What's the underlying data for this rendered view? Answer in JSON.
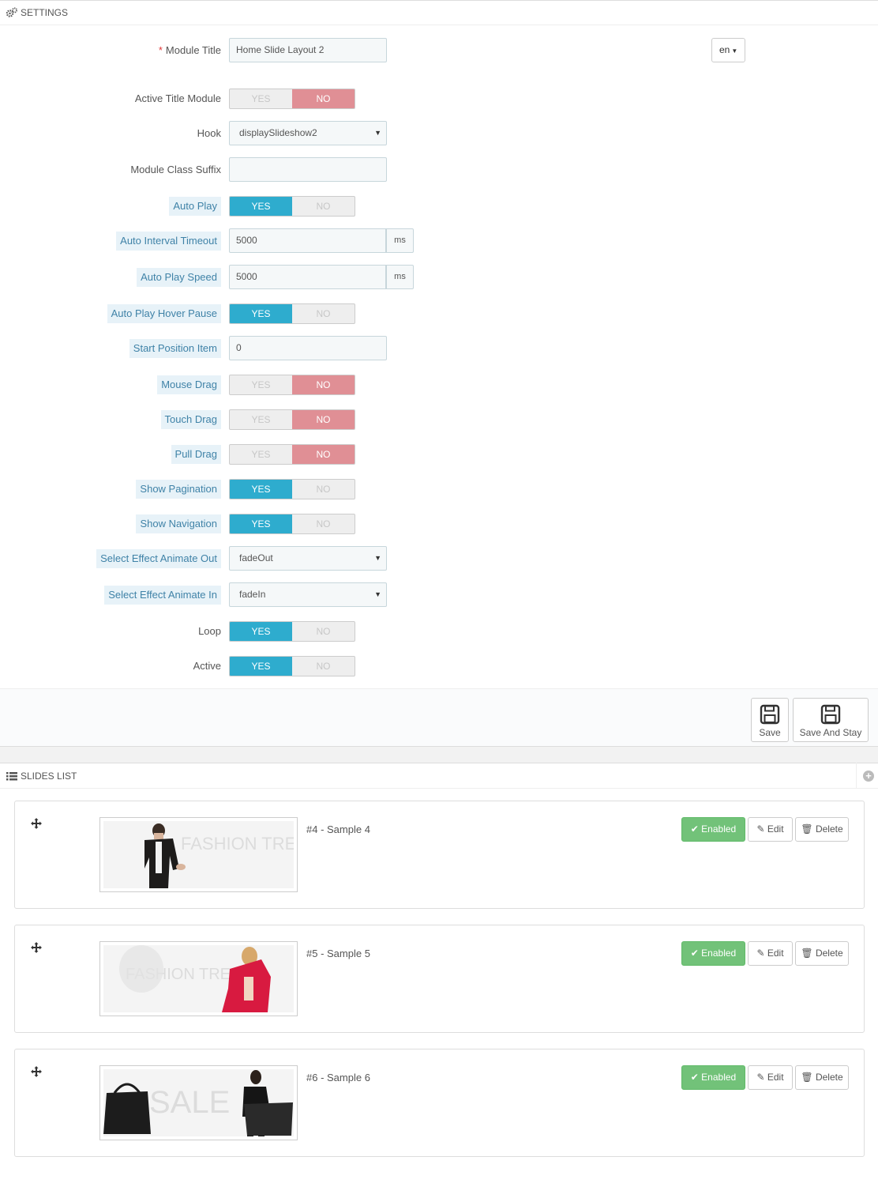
{
  "settings": {
    "heading": "SETTINGS",
    "language": "en",
    "module_title": {
      "label": "Module Title",
      "value": "Home Slide Layout 2"
    },
    "active_title_module": {
      "label": "Active Title Module",
      "value": "NO"
    },
    "hook": {
      "label": "Hook",
      "value": "displaySlideshow2"
    },
    "module_class_suffix": {
      "label": "Module Class Suffix",
      "value": ""
    },
    "auto_play": {
      "label": "Auto Play",
      "value": "YES"
    },
    "auto_interval_timeout": {
      "label": "Auto Interval Timeout",
      "value": "5000",
      "unit": "ms"
    },
    "auto_play_speed": {
      "label": "Auto Play Speed",
      "value": "5000",
      "unit": "ms"
    },
    "auto_play_hover_pause": {
      "label": "Auto Play Hover Pause",
      "value": "YES"
    },
    "start_position_item": {
      "label": "Start Position Item",
      "value": "0"
    },
    "mouse_drag": {
      "label": "Mouse Drag",
      "value": "NO"
    },
    "touch_drag": {
      "label": "Touch Drag",
      "value": "NO"
    },
    "pull_drag": {
      "label": "Pull Drag",
      "value": "NO"
    },
    "show_pagination": {
      "label": "Show Pagination",
      "value": "YES"
    },
    "show_navigation": {
      "label": "Show Navigation",
      "value": "YES"
    },
    "select_effect_animate_out": {
      "label": "Select Effect Animate Out",
      "value": "fadeOut"
    },
    "select_effect_animate_in": {
      "label": "Select Effect Animate In",
      "value": "fadeIn"
    },
    "loop": {
      "label": "Loop",
      "value": "YES"
    },
    "active": {
      "label": "Active",
      "value": "YES"
    },
    "switch_labels": {
      "yes": "YES",
      "no": "NO"
    },
    "save_label": "Save",
    "save_and_stay_label": "Save And Stay"
  },
  "slides_list": {
    "heading": "SLIDES LIST",
    "items": [
      {
        "title": "#4 - Sample 4",
        "status": "Enabled",
        "edit": "Edit",
        "delete": "Delete",
        "image_text": "FASHION TREND"
      },
      {
        "title": "#5 - Sample 5",
        "status": "Enabled",
        "edit": "Edit",
        "delete": "Delete",
        "image_text": "FASHION TREND"
      },
      {
        "title": "#6 - Sample 6",
        "status": "Enabled",
        "edit": "Edit",
        "delete": "Delete",
        "image_text": "SALE"
      }
    ]
  },
  "colors": {
    "yes_active": "#2eacce",
    "no_active": "#e08f95",
    "enabled": "#72c279",
    "hint_bg": "#e7f2f8",
    "hint_text": "#3f82a7"
  }
}
